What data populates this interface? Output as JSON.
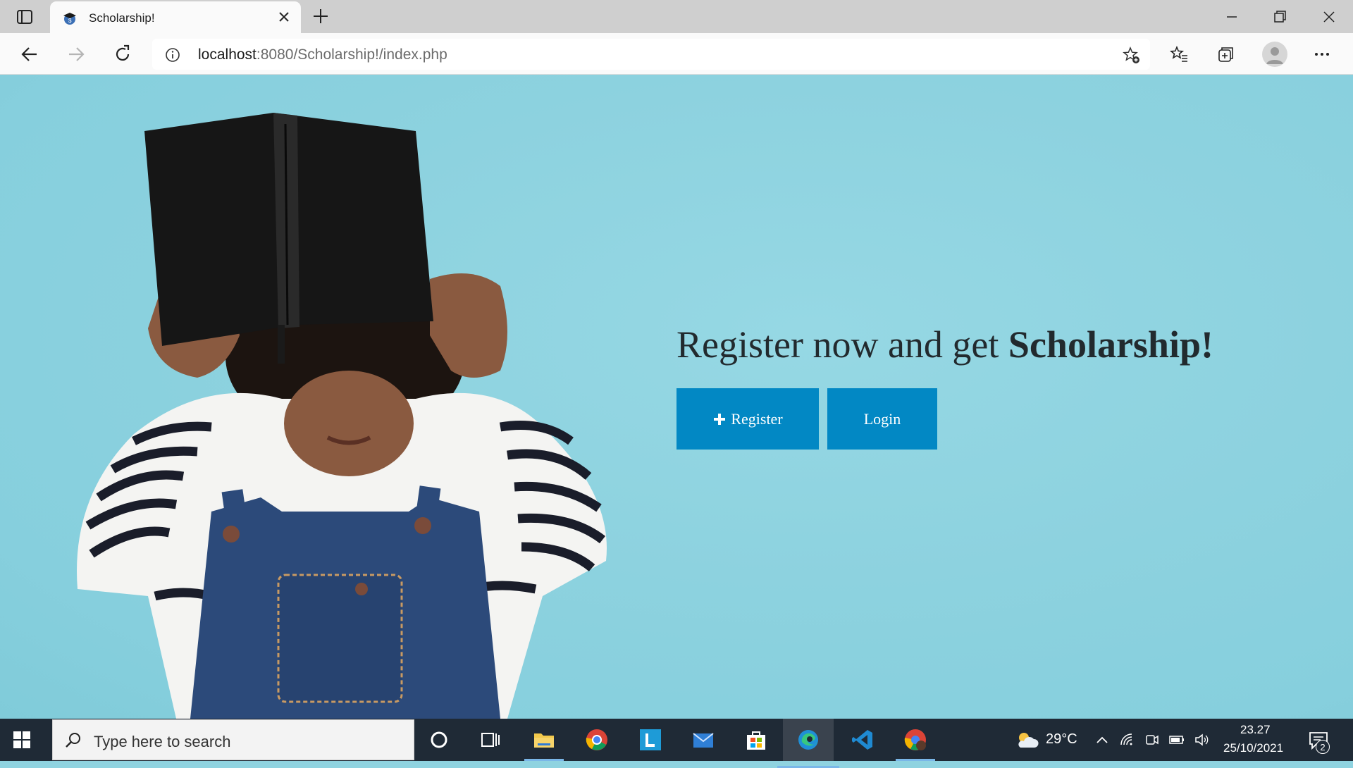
{
  "browser": {
    "tab": {
      "title": "Scholarship!",
      "favicon": "graduation-cap-icon"
    },
    "address": {
      "host": "localhost",
      "path": ":8080/Scholarship!/index.php"
    }
  },
  "hero": {
    "headline_prefix": "Register now and get ",
    "headline_bold": "Scholarship!",
    "register_label": "Register",
    "login_label": "Login",
    "button_color": "#0288c4",
    "background_color": "#8dd2df"
  },
  "taskbar": {
    "search_placeholder": "Type here to search",
    "weather_temp": "29°C",
    "time": "23.27",
    "date": "25/10/2021",
    "notification_count": "2"
  }
}
